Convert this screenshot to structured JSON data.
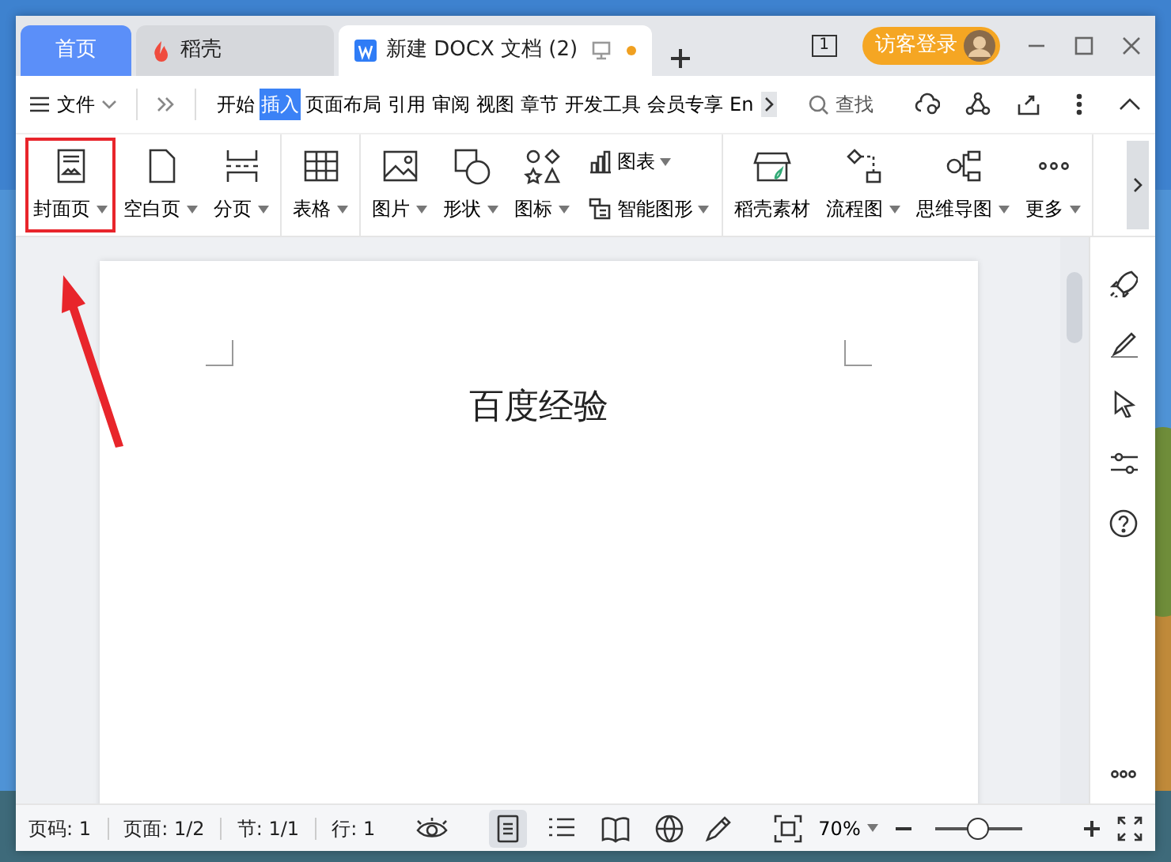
{
  "tabs": [
    {
      "label": "首页",
      "kind": "home",
      "selected": false
    },
    {
      "label": "稻壳",
      "kind": "app",
      "selected": false
    },
    {
      "label": "新建 DOCX 文档 (2)",
      "kind": "doc",
      "selected": true,
      "unsaved": true
    }
  ],
  "page_count_badge": "1",
  "login_button": "访客登录",
  "menu": {
    "file": "文件",
    "ribbon_tabs": [
      {
        "label": "开始",
        "selected": false
      },
      {
        "label": "插入",
        "selected": true
      },
      {
        "label": "页面布局",
        "selected": false
      },
      {
        "label": "引用",
        "selected": false
      },
      {
        "label": "审阅",
        "selected": false
      },
      {
        "label": "视图",
        "selected": false
      },
      {
        "label": "章节",
        "selected": false
      },
      {
        "label": "开发工具",
        "selected": false
      },
      {
        "label": "会员专享",
        "selected": false
      },
      {
        "label": "En",
        "selected": false
      }
    ],
    "search": "查找"
  },
  "ribbon": [
    [
      {
        "label": "封面页",
        "dropdown": true,
        "highlighted": true
      },
      {
        "label": "空白页",
        "dropdown": true,
        "highlighted": false
      },
      {
        "label": "分页",
        "dropdown": true,
        "highlighted": false
      }
    ],
    [
      {
        "label": "表格",
        "dropdown": true,
        "highlighted": false
      }
    ],
    [
      {
        "label": "图片",
        "dropdown": true,
        "highlighted": false
      },
      {
        "label": "形状",
        "dropdown": true,
        "highlighted": false
      },
      {
        "label": "图标",
        "dropdown": true,
        "highlighted": false
      },
      {
        "kind": "stack",
        "items": [
          {
            "label": "图表",
            "dropdown": true
          },
          {
            "label": "智能图形",
            "dropdown": true
          }
        ]
      }
    ],
    [
      {
        "label": "稻壳素材",
        "dropdown": false,
        "highlighted": false
      },
      {
        "label": "流程图",
        "dropdown": true,
        "highlighted": false
      },
      {
        "label": "思维导图",
        "dropdown": true,
        "highlighted": false
      },
      {
        "label": "更多",
        "dropdown": true,
        "highlighted": false
      }
    ]
  ],
  "document": {
    "text": "百度经验"
  },
  "status_bar": {
    "fields": [
      "页码: 1",
      "页面: 1/2",
      "节: 1/1",
      "行: 1"
    ],
    "view_modes": [
      {
        "selected": true
      },
      {
        "selected": false
      },
      {
        "selected": false
      },
      {
        "selected": false
      }
    ],
    "zoom": "70%",
    "zoom_slider": {
      "level": 0.5
    }
  }
}
